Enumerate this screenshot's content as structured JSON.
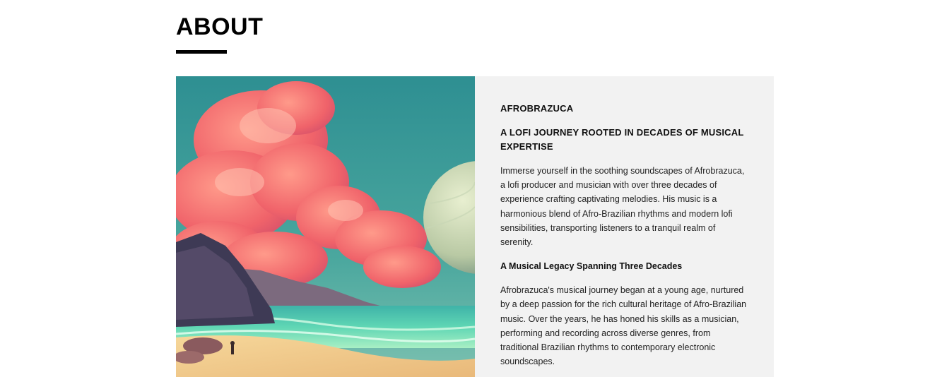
{
  "about": {
    "title": "ABOUT",
    "image_alt": "Surreal beach scene with pink clouds and a planet",
    "artist_name": "AFROBRAZUCA",
    "tagline": "A LOFI JOURNEY ROOTED IN DECADES OF MUSICAL EXPERTISE",
    "intro": "Immerse yourself in the soothing soundscapes of Afrobrazuca, a lofi producer and musician with over three decades of experience crafting captivating melodies. His music is a harmonious blend of Afro-Brazilian rhythms and modern lofi sensibilities, transporting listeners to a tranquil realm of serenity.",
    "legacy_heading": "A Musical Legacy Spanning Three Decades",
    "legacy_text": "Afrobrazuca's musical journey began at a young age, nurtured by a deep passion for the rich cultural heritage of Afro-Brazilian music. Over the years, he has honed his skills as a musician, performing and recording across diverse genres, from traditional Brazilian rhythms to contemporary electronic soundscapes."
  },
  "colors": {
    "panel_bg": "#f2f2f2",
    "accent": "#000000"
  }
}
